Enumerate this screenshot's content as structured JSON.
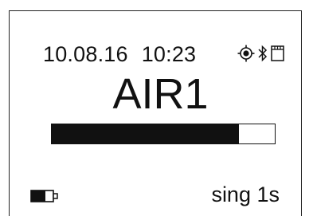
{
  "display": {
    "date": "10.08.16",
    "time": "10:23",
    "station": "AIR1",
    "status_text": "sing 1s",
    "level_fraction": 0.84,
    "icons": [
      "gps-icon",
      "bluetooth-icon",
      "sd-card-icon",
      "battery-icon"
    ],
    "colors": {
      "foreground": "#111111",
      "background": "#ffffff"
    }
  }
}
